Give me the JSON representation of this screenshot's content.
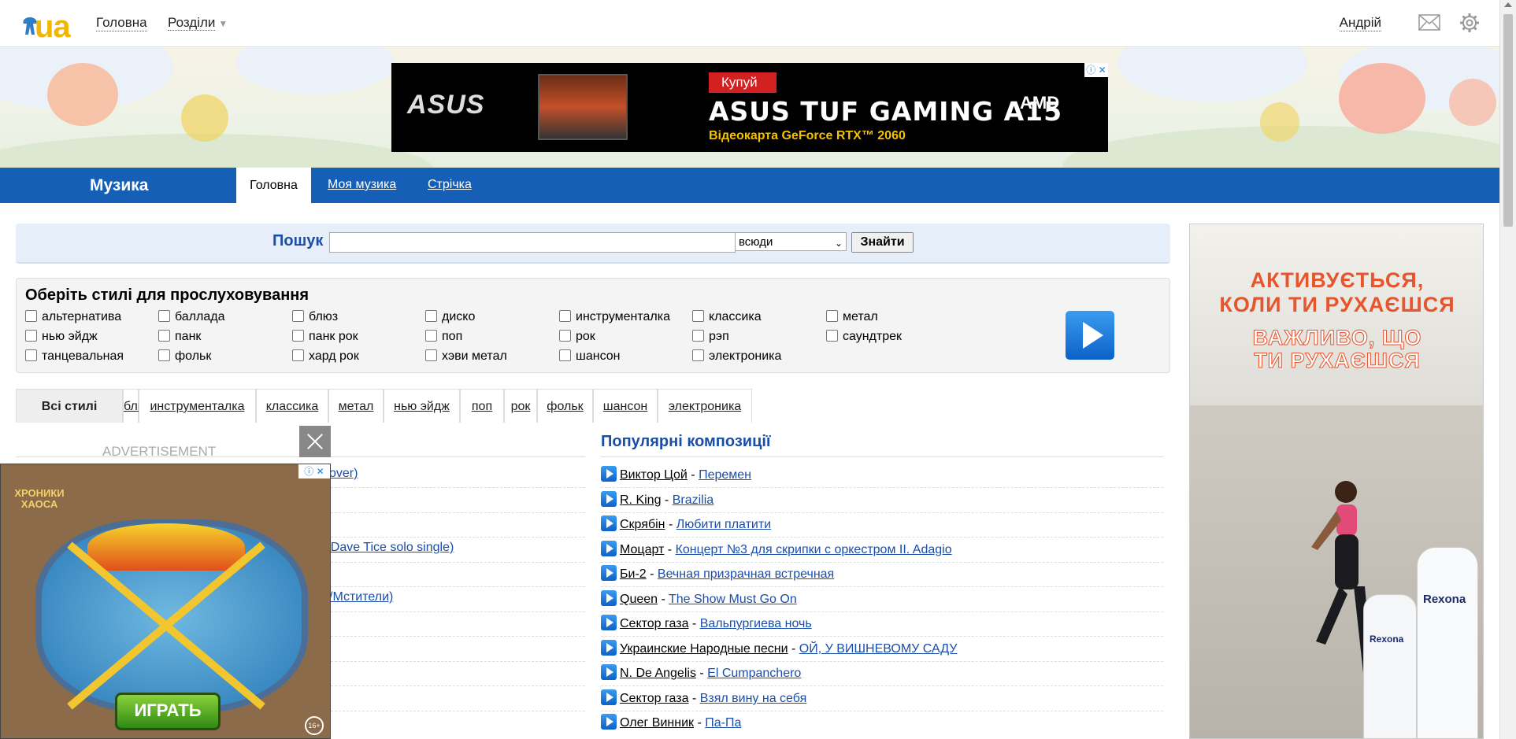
{
  "header": {
    "logo_text": "ua",
    "nav_home": "Головна",
    "nav_sections": "Розділи",
    "user_name": "Андрій"
  },
  "top_ad": {
    "badge": "Купуй",
    "brand": "ASUS",
    "title": "ASUS TUF GAMING A15",
    "subtitle": "Відеокарта GeForce RTX™ 2060",
    "partner": "AMD",
    "adchoices": "ⓘ ✕"
  },
  "section_nav": {
    "title": "Музика",
    "tabs": [
      "Головна",
      "Моя музика",
      "Стрічка"
    ]
  },
  "search": {
    "label": "Пошук",
    "placeholder": "",
    "scope_value": "всюди",
    "button": "Знайти"
  },
  "styles_panel": {
    "title": "Оберіть стилі для прослуховування",
    "columns": [
      [
        "альтернатива",
        "нью эйдж",
        "танцевальная"
      ],
      [
        "баллада",
        "панк",
        "фольк"
      ],
      [
        "блюз",
        "панк рок",
        "хард рок"
      ],
      [
        "диско",
        "поп",
        "хэви метал"
      ],
      [
        "инструменталка",
        "рок",
        "шансон"
      ],
      [
        "классика",
        "рэп",
        "электроника"
      ],
      [
        "метал",
        "саундтрек"
      ]
    ]
  },
  "style_tabs": [
    "Всі стилі",
    "блюз",
    "инструменталка",
    "классика",
    "метал",
    "нью эйдж",
    "поп",
    "рок",
    "фольк",
    "шансон",
    "электроника"
  ],
  "left_fragments": [
    "cover)",
    "- Dave Tice solo single)",
    "s/Мстители)"
  ],
  "popular": {
    "title": "Популярні композиції",
    "tracks": [
      {
        "artist": "Виктор Цой",
        "song": "Перемен"
      },
      {
        "artist": "R. King",
        "song": "Brazilia"
      },
      {
        "artist": "Скрябін",
        "song": "Любити платити"
      },
      {
        "artist": "Моцарт",
        "song": "Концерт №3 для скрипки с оркестром II. Adagio"
      },
      {
        "artist": "Би-2",
        "song": "Вечная призрачная встречная"
      },
      {
        "artist": "Queen",
        "song": "The Show Must Go On"
      },
      {
        "artist": "Сектор газа",
        "song": "Вальпургиева ночь"
      },
      {
        "artist": "Украинские Народные песни",
        "song": "ОЙ, У ВИШНЕВОМУ САДУ"
      },
      {
        "artist": "N. De Angelis",
        "song": "El Cumpanchero"
      },
      {
        "artist": "Сектор газа",
        "song": "Взял вину на себя"
      },
      {
        "artist": "Олег Винник",
        "song": "Па-Па"
      }
    ]
  },
  "float_ad": {
    "label": "ADVERTISEMENT",
    "logo": "ХРОНИКИ ХАОСА",
    "play": "ИГРАТЬ",
    "age": "16+",
    "adchoices": "ⓘ ✕"
  },
  "right_ad": {
    "headline": "АКТИВУЄТЬСЯ, КОЛИ ТИ РУХАЄШСЯ",
    "headline_lines": [
      "АКТИВУЄТЬСЯ,",
      "КОЛИ ТИ РУХАЄШСЯ"
    ],
    "sub_lines": [
      "ВАЖЛИВО, ЩО",
      "ТИ РУХАЄШСЯ"
    ],
    "brand1": "Rexona",
    "brand2": "Rexona"
  },
  "colors": {
    "brand_blue": "#1560b6",
    "link_blue": "#1a4ea8",
    "logo_yellow": "#f2b600"
  }
}
